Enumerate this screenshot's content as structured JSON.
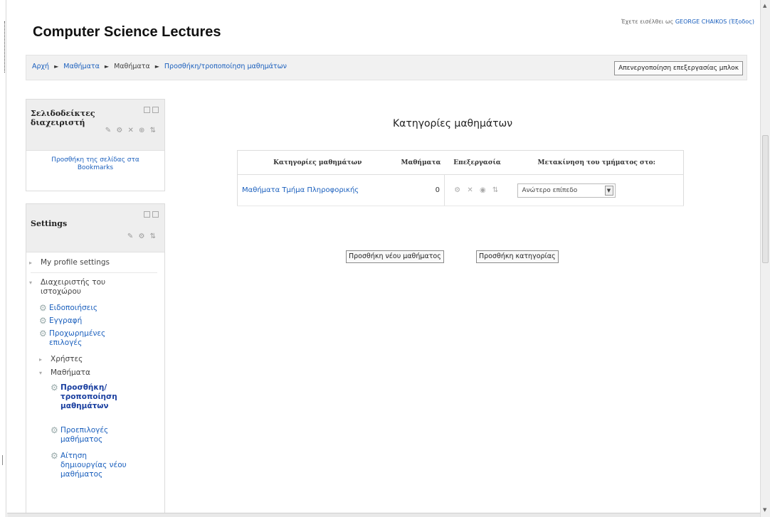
{
  "login_info": {
    "prefix": "Έχετε εισέλθει ως",
    "user": "GEORGE CHAIKOS",
    "logout": "(Έξοδος)"
  },
  "site_title": "Computer Science Lectures",
  "breadcrumb": [
    {
      "label": "Αρχή",
      "link": true
    },
    {
      "label": "Μαθήματα",
      "link": true
    },
    {
      "label": "Μαθήματα",
      "link": false
    },
    {
      "label": "Προσθήκη/τροποποίηση μαθημάτων",
      "link": true
    }
  ],
  "breadcrumb_separator": "►",
  "edit_button": "Απενεργοποίηση επεξεργασίας μπλοκ",
  "bookmarks_block": {
    "title": "Σελιδοδείκτες διαχειριστή",
    "link": "Προσθήκη της σελίδας στα Bookmarks",
    "edit_icons": "✎ ⚙ ✕ ⊕ ⇅"
  },
  "settings_block": {
    "title": "Settings",
    "edit_icons": "✎ ⚙ ⇅",
    "items": [
      {
        "type": "plain",
        "tri": "▸",
        "label": "My profile settings"
      },
      {
        "type": "plain",
        "tri": "▾",
        "label": "Διαχειριστής του ιστοχώρου"
      },
      {
        "type": "link",
        "gear": true,
        "label": "Ειδοποιήσεις"
      },
      {
        "type": "link",
        "gear": true,
        "label": "Εγγραφή"
      },
      {
        "type": "link",
        "gear": true,
        "label": "Προχωρημένες επιλογές"
      },
      {
        "type": "plain",
        "tri": "▸",
        "label": "Χρήστες"
      },
      {
        "type": "plain",
        "tri": "▾",
        "label": "Μαθήματα"
      },
      {
        "type": "bold",
        "gear": true,
        "label": "Προσθήκη/τροποποίηση μαθημάτων"
      },
      {
        "type": "link",
        "gear": true,
        "label": "Προεπιλογές μαθήματος"
      },
      {
        "type": "link",
        "gear": true,
        "label": "Αίτηση δημιουργίας νέου μαθήματος"
      }
    ]
  },
  "main": {
    "heading": "Κατηγορίες μαθημάτων",
    "table": {
      "headers": [
        "Κατηγορίες μαθημάτων",
        "Μαθήματα",
        "Επεξεργασία",
        "Μετακίνηση του τμήματος στο:"
      ],
      "rows": [
        {
          "category": "Μαθήματα Τμήμα Πληροφορικής",
          "courses": "0",
          "edit_icons": "⚙ ✕ ◉ ⇅",
          "move_to": "Ανώτερο επίπεδο"
        }
      ]
    },
    "add_course_button": "Προσθήκη νέου μαθήματος",
    "add_category_button": "Προσθήκη κατηγορίας"
  },
  "colors": {
    "link": "#1a5fbd",
    "block_header_bg": "#eeeeee",
    "navbar_bg": "#f1f1f1"
  }
}
